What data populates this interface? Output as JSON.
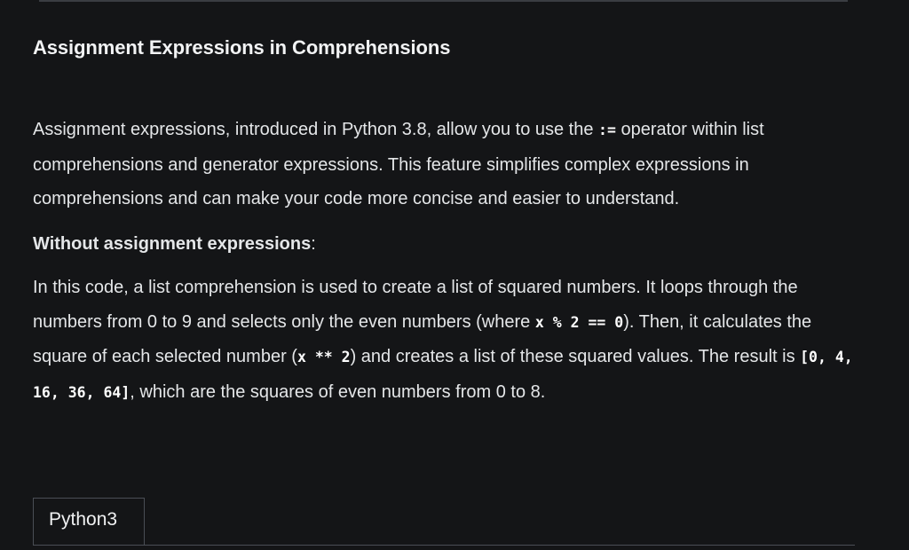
{
  "article": {
    "heading": "Assignment Expressions in Comprehensions",
    "intro": {
      "before": "Assignment expressions, introduced in Python 3.8, allow you to use the ",
      "code": ":=",
      "after": " operator within list comprehensions and generator expressions. This feature simplifies complex expressions in comprehensions and can make your code more concise and easier to understand."
    },
    "subheading": {
      "bold": "Without assignment expressions",
      "suffix": ":"
    },
    "explanation": {
      "t1": "In this code, a list comprehension is used to create a list of squared numbers. It loops through the numbers from 0 to 9 and selects only the even numbers (where ",
      "c1": "x % 2 == 0",
      "t2": "). Then, it calculates the square of each selected number (",
      "c2": "x ** 2",
      "t3": ") and creates a list of these squared values. The result is ",
      "c3": "[0, 4, 16, 36, 64]",
      "t4": ", which are the squares of even numbers from 0 to 8."
    }
  },
  "code_tabs": {
    "active_label": "Python3"
  }
}
